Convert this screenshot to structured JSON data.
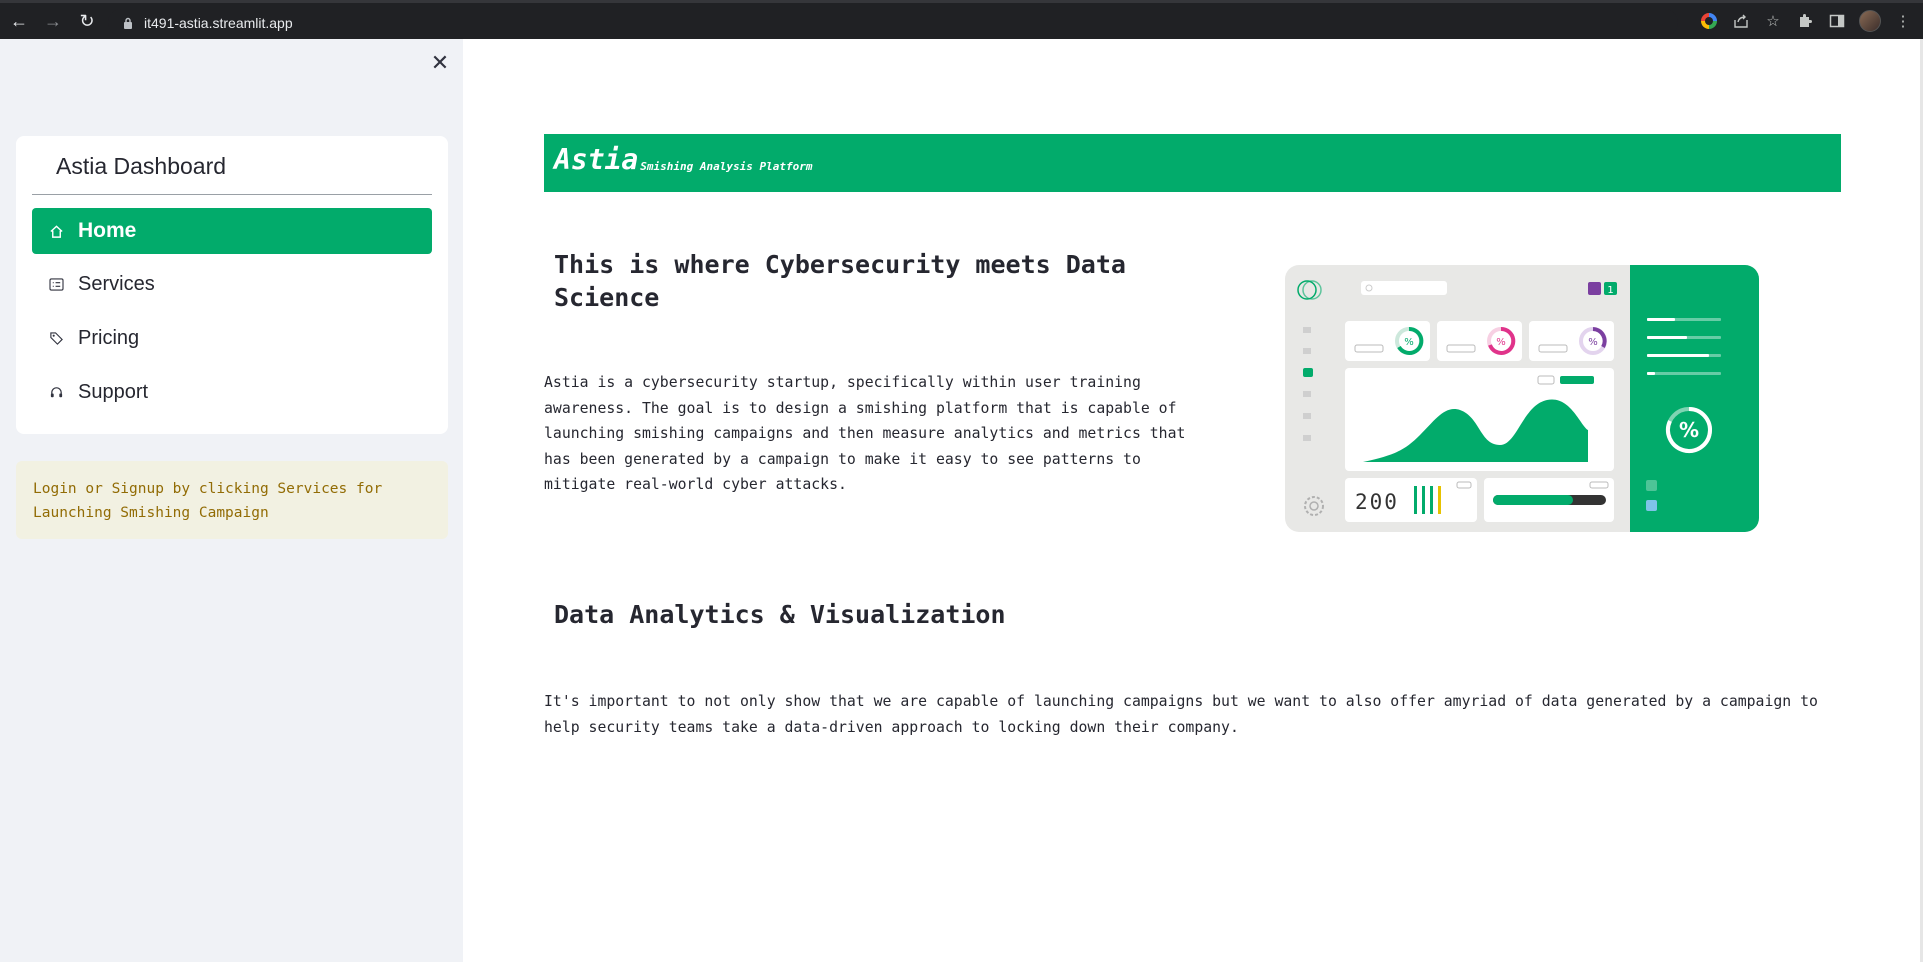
{
  "browser": {
    "url": "it491-astia.streamlit.app",
    "back_icon": "arrow-left-icon",
    "forward_icon": "arrow-right-icon",
    "reload_icon": "reload-icon"
  },
  "sidebar": {
    "menu_title": "Astia Dashboard",
    "items": [
      {
        "label": "Home",
        "icon": "house-icon",
        "active": true
      },
      {
        "label": "Services",
        "icon": "card-list-icon",
        "active": false
      },
      {
        "label": "Pricing",
        "icon": "tags-icon",
        "active": false
      },
      {
        "label": "Support",
        "icon": "headset-icon",
        "active": false
      }
    ],
    "info_text_line1": "Login or Signup by clicking Services for",
    "info_text_line2": "Launching Smishing Campaign"
  },
  "main": {
    "banner_title": "Astia",
    "banner_subtitle": "Smishing Analysis Platform",
    "section1": {
      "heading_line1": "This is where Cybersecurity meets Data",
      "heading_line2": "Science",
      "paragraph_lines": [
        "Astia is a cybersecurity startup, specifically within user training",
        "awareness. The goal is to design a smishing platform that is capable of",
        "launching smishing campaigns and then measure analytics and metrics that",
        "has been generated by a campaign to make it easy to see patterns to",
        "mitigate real-world cyber attacks."
      ]
    },
    "section2": {
      "heading": "Data Analytics & Visualization",
      "paragraph_lines": [
        "It's important to not only show that we are capable of launching campaigns but we want to also offer amyriad of data generated by a campaign to",
        "help security teams take a data-driven approach to locking down their company."
      ]
    },
    "illustration": {
      "counter": "200",
      "percent_symbol": "%",
      "badge": "1"
    }
  },
  "colors": {
    "accent": "#02ab6b",
    "sidebar_bg": "#f0f2f6",
    "info_bg": "#f2f1e2",
    "info_text": "#926c05"
  }
}
